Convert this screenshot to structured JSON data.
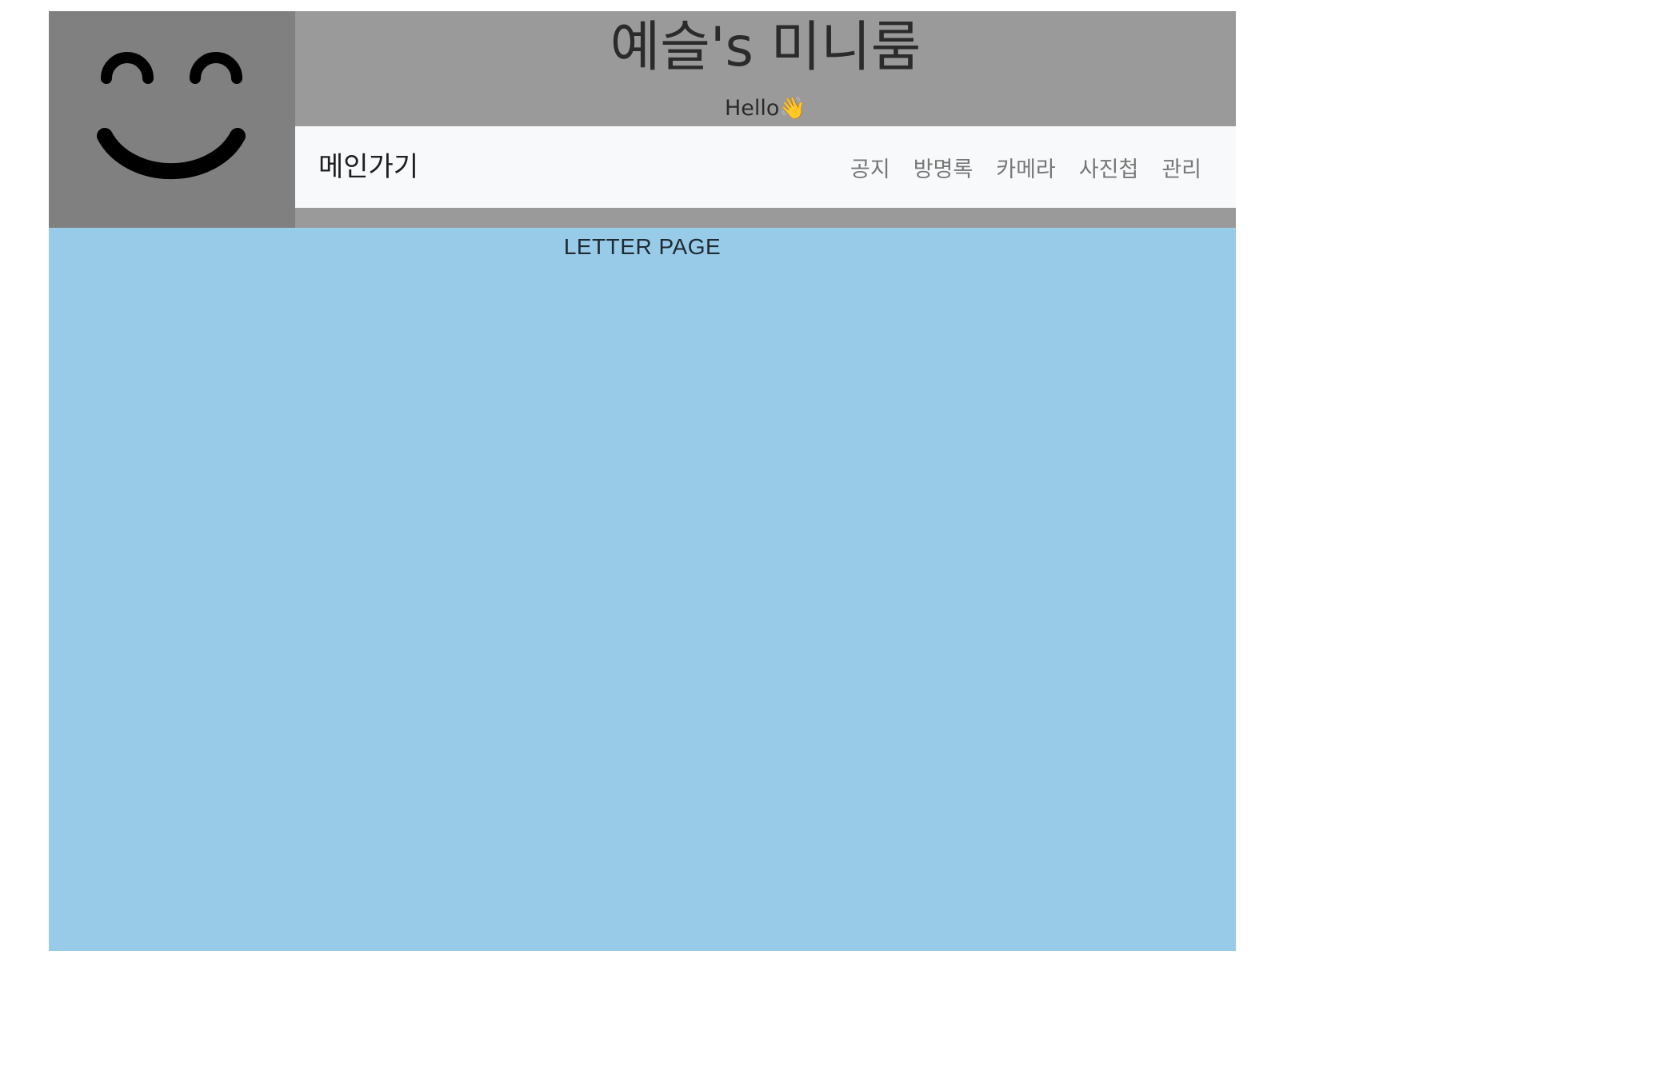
{
  "header": {
    "title": "예슬's 미니룸",
    "greeting": "Hello👋",
    "logo_icon": "smiley-face-icon",
    "logo_bg": "#808080",
    "header_bg": "#9a9a9a"
  },
  "navbar": {
    "brand": "메인가기",
    "links": [
      {
        "label": "공지"
      },
      {
        "label": "방명록"
      },
      {
        "label": "카메라"
      },
      {
        "label": "사진첩"
      },
      {
        "label": "관리"
      }
    ],
    "bg": "#f8f9fa"
  },
  "main": {
    "heading": "LETTER PAGE",
    "bg": "#97cbe7"
  }
}
